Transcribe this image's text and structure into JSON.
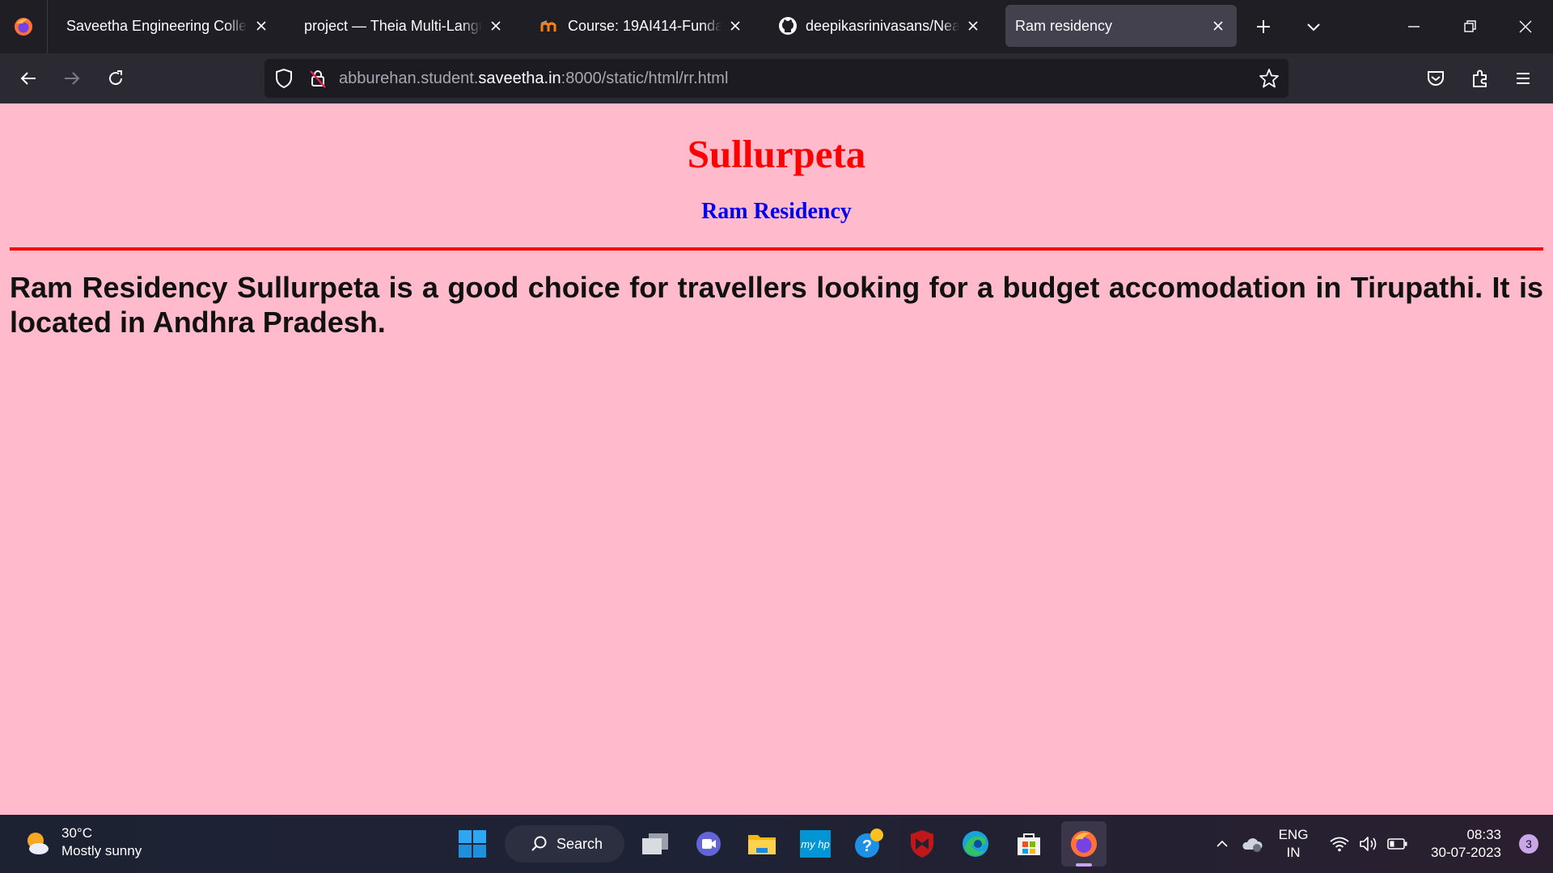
{
  "browser": {
    "tabs": [
      {
        "title": "Saveetha Engineering College",
        "icon": "globe-icon"
      },
      {
        "title": "project — Theia Multi-Language",
        "icon": "none"
      },
      {
        "title": "Course: 19AI414-Fundamentals",
        "icon": "moodle-icon"
      },
      {
        "title": "deepikasrinivasans/NearMe",
        "icon": "github-icon"
      },
      {
        "title": "Ram residency",
        "icon": "none",
        "active": true
      }
    ],
    "url": {
      "prefix": "abburehan.student.",
      "domain": "saveetha.in",
      "suffix": ":8000/static/html/rr.html"
    }
  },
  "page": {
    "background": "#ffbbcc",
    "heading": "Sullurpeta",
    "subheading": "Ram Residency",
    "heading_color": "#ff0000",
    "subheading_color": "#0000ee",
    "rule_color": "#ff0000",
    "paragraph": "Ram Residency Sullurpeta is a good choice for travellers looking for a budget accomodation in Tirupathi. It is located in Andhra Pradesh."
  },
  "taskbar": {
    "weather": {
      "temp": "30°C",
      "condition": "Mostly sunny"
    },
    "search_label": "Search",
    "language": {
      "line1": "ENG",
      "line2": "IN"
    },
    "time": "08:33",
    "date": "30-07-2023",
    "notification_count": "3"
  }
}
